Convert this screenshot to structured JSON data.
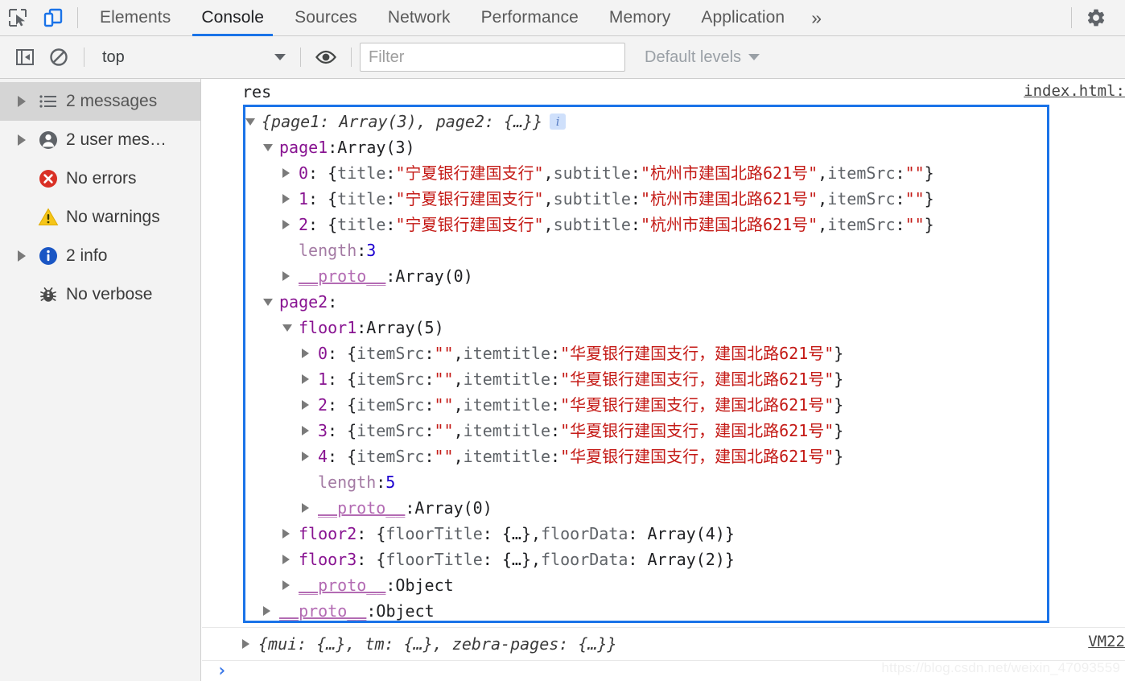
{
  "tabbar": {
    "inspect_icon": "inspect-element-icon",
    "device_icon": "device-toolbar-icon",
    "tabs": [
      {
        "label": "Elements",
        "active": false
      },
      {
        "label": "Console",
        "active": true
      },
      {
        "label": "Sources",
        "active": false
      },
      {
        "label": "Network",
        "active": false
      },
      {
        "label": "Performance",
        "active": false
      },
      {
        "label": "Memory",
        "active": false
      },
      {
        "label": "Application",
        "active": false
      }
    ],
    "more_label": "»",
    "settings_icon": "gear-icon"
  },
  "filterbar": {
    "sidebar_toggle_icon": "show-console-sidebar-icon",
    "clear_icon": "clear-console-icon",
    "context": "top",
    "eye_icon": "live-expression-icon",
    "filter_value": "",
    "filter_placeholder": "Filter",
    "levels_label": "Default levels"
  },
  "sidebar": {
    "items": [
      {
        "label": "2 messages",
        "icon": "list-icon",
        "expandable": true,
        "selected": true
      },
      {
        "label": "2 user mes…",
        "icon": "user-icon",
        "expandable": true,
        "selected": false
      },
      {
        "label": "No errors",
        "icon": "error-icon",
        "expandable": false,
        "selected": false
      },
      {
        "label": "No warnings",
        "icon": "warning-icon",
        "expandable": false,
        "selected": false
      },
      {
        "label": "2 info",
        "icon": "info-icon",
        "expandable": true,
        "selected": false
      },
      {
        "label": "No verbose",
        "icon": "bug-icon",
        "expandable": false,
        "selected": false
      }
    ]
  },
  "console": {
    "res_label": "res",
    "source_link": "index.html:",
    "vm_link": "VM22",
    "info_badge": "i",
    "root_preview": "{page1: Array(3), page2: {…}}",
    "tree": [
      {
        "indent": 0,
        "arrow": "down",
        "parts": [
          {
            "t": "{page1: Array(3), page2: {…}}",
            "c": "t-italic"
          }
        ],
        "badge": true
      },
      {
        "indent": 1,
        "arrow": "down",
        "parts": [
          {
            "t": "page1",
            "c": "k-prop"
          },
          {
            "t": ": ",
            "c": "t-plain"
          },
          {
            "t": "Array(3)",
            "c": "t-plain"
          }
        ]
      },
      {
        "indent": 2,
        "arrow": "right",
        "parts": [
          {
            "t": "0",
            "c": "k-idx"
          },
          {
            "t": ": {",
            "c": "t-plain"
          },
          {
            "t": "title",
            "c": "t-dim"
          },
          {
            "t": ": ",
            "c": "t-plain"
          },
          {
            "t": "\"宁夏银行建国支行\"",
            "c": "t-str"
          },
          {
            "t": ", ",
            "c": "t-plain"
          },
          {
            "t": "subtitle",
            "c": "t-dim"
          },
          {
            "t": ": ",
            "c": "t-plain"
          },
          {
            "t": "\"杭州市建国北路621号\"",
            "c": "t-str"
          },
          {
            "t": ", ",
            "c": "t-plain"
          },
          {
            "t": "itemSrc",
            "c": "t-dim"
          },
          {
            "t": ": ",
            "c": "t-plain"
          },
          {
            "t": "\"\"",
            "c": "t-str"
          },
          {
            "t": "}",
            "c": "t-plain"
          }
        ]
      },
      {
        "indent": 2,
        "arrow": "right",
        "parts": [
          {
            "t": "1",
            "c": "k-idx"
          },
          {
            "t": ": {",
            "c": "t-plain"
          },
          {
            "t": "title",
            "c": "t-dim"
          },
          {
            "t": ": ",
            "c": "t-plain"
          },
          {
            "t": "\"宁夏银行建国支行\"",
            "c": "t-str"
          },
          {
            "t": ", ",
            "c": "t-plain"
          },
          {
            "t": "subtitle",
            "c": "t-dim"
          },
          {
            "t": ": ",
            "c": "t-plain"
          },
          {
            "t": "\"杭州市建国北路621号\"",
            "c": "t-str"
          },
          {
            "t": ", ",
            "c": "t-plain"
          },
          {
            "t": "itemSrc",
            "c": "t-dim"
          },
          {
            "t": ": ",
            "c": "t-plain"
          },
          {
            "t": "\"\"",
            "c": "t-str"
          },
          {
            "t": "}",
            "c": "t-plain"
          }
        ]
      },
      {
        "indent": 2,
        "arrow": "right",
        "parts": [
          {
            "t": "2",
            "c": "k-idx"
          },
          {
            "t": ": {",
            "c": "t-plain"
          },
          {
            "t": "title",
            "c": "t-dim"
          },
          {
            "t": ": ",
            "c": "t-plain"
          },
          {
            "t": "\"宁夏银行建国支行\"",
            "c": "t-str"
          },
          {
            "t": ", ",
            "c": "t-plain"
          },
          {
            "t": "subtitle",
            "c": "t-dim"
          },
          {
            "t": ": ",
            "c": "t-plain"
          },
          {
            "t": "\"杭州市建国北路621号\"",
            "c": "t-str"
          },
          {
            "t": ", ",
            "c": "t-plain"
          },
          {
            "t": "itemSrc",
            "c": "t-dim"
          },
          {
            "t": ": ",
            "c": "t-plain"
          },
          {
            "t": "\"\"",
            "c": "t-str"
          },
          {
            "t": "}",
            "c": "t-plain"
          }
        ]
      },
      {
        "indent": 2,
        "arrow": "none",
        "parts": [
          {
            "t": "length",
            "c": "k-len"
          },
          {
            "t": ": ",
            "c": "t-plain"
          },
          {
            "t": "3",
            "c": "t-num"
          }
        ]
      },
      {
        "indent": 2,
        "arrow": "right",
        "parts": [
          {
            "t": "__proto__",
            "c": "k-proto"
          },
          {
            "t": ": ",
            "c": "t-plain"
          },
          {
            "t": "Array(0)",
            "c": "t-plain"
          }
        ]
      },
      {
        "indent": 1,
        "arrow": "down",
        "parts": [
          {
            "t": "page2",
            "c": "k-prop"
          },
          {
            "t": ":",
            "c": "t-plain"
          }
        ]
      },
      {
        "indent": 2,
        "arrow": "down",
        "parts": [
          {
            "t": "floor1",
            "c": "k-prop"
          },
          {
            "t": ": ",
            "c": "t-plain"
          },
          {
            "t": "Array(5)",
            "c": "t-plain"
          }
        ]
      },
      {
        "indent": 3,
        "arrow": "right",
        "parts": [
          {
            "t": "0",
            "c": "k-idx"
          },
          {
            "t": ": {",
            "c": "t-plain"
          },
          {
            "t": "itemSrc",
            "c": "t-dim"
          },
          {
            "t": ": ",
            "c": "t-plain"
          },
          {
            "t": "\"\"",
            "c": "t-str"
          },
          {
            "t": ", ",
            "c": "t-plain"
          },
          {
            "t": "itemtitle",
            "c": "t-dim"
          },
          {
            "t": ": ",
            "c": "t-plain"
          },
          {
            "t": "\"华夏银行建国支行，建国北路621号\"",
            "c": "t-str"
          },
          {
            "t": "}",
            "c": "t-plain"
          }
        ]
      },
      {
        "indent": 3,
        "arrow": "right",
        "parts": [
          {
            "t": "1",
            "c": "k-idx"
          },
          {
            "t": ": {",
            "c": "t-plain"
          },
          {
            "t": "itemSrc",
            "c": "t-dim"
          },
          {
            "t": ": ",
            "c": "t-plain"
          },
          {
            "t": "\"\"",
            "c": "t-str"
          },
          {
            "t": ", ",
            "c": "t-plain"
          },
          {
            "t": "itemtitle",
            "c": "t-dim"
          },
          {
            "t": ": ",
            "c": "t-plain"
          },
          {
            "t": "\"华夏银行建国支行，建国北路621号\"",
            "c": "t-str"
          },
          {
            "t": "}",
            "c": "t-plain"
          }
        ]
      },
      {
        "indent": 3,
        "arrow": "right",
        "parts": [
          {
            "t": "2",
            "c": "k-idx"
          },
          {
            "t": ": {",
            "c": "t-plain"
          },
          {
            "t": "itemSrc",
            "c": "t-dim"
          },
          {
            "t": ": ",
            "c": "t-plain"
          },
          {
            "t": "\"\"",
            "c": "t-str"
          },
          {
            "t": ", ",
            "c": "t-plain"
          },
          {
            "t": "itemtitle",
            "c": "t-dim"
          },
          {
            "t": ": ",
            "c": "t-plain"
          },
          {
            "t": "\"华夏银行建国支行，建国北路621号\"",
            "c": "t-str"
          },
          {
            "t": "}",
            "c": "t-plain"
          }
        ]
      },
      {
        "indent": 3,
        "arrow": "right",
        "parts": [
          {
            "t": "3",
            "c": "k-idx"
          },
          {
            "t": ": {",
            "c": "t-plain"
          },
          {
            "t": "itemSrc",
            "c": "t-dim"
          },
          {
            "t": ": ",
            "c": "t-plain"
          },
          {
            "t": "\"\"",
            "c": "t-str"
          },
          {
            "t": ", ",
            "c": "t-plain"
          },
          {
            "t": "itemtitle",
            "c": "t-dim"
          },
          {
            "t": ": ",
            "c": "t-plain"
          },
          {
            "t": "\"华夏银行建国支行，建国北路621号\"",
            "c": "t-str"
          },
          {
            "t": "}",
            "c": "t-plain"
          }
        ]
      },
      {
        "indent": 3,
        "arrow": "right",
        "parts": [
          {
            "t": "4",
            "c": "k-idx"
          },
          {
            "t": ": {",
            "c": "t-plain"
          },
          {
            "t": "itemSrc",
            "c": "t-dim"
          },
          {
            "t": ": ",
            "c": "t-plain"
          },
          {
            "t": "\"\"",
            "c": "t-str"
          },
          {
            "t": ", ",
            "c": "t-plain"
          },
          {
            "t": "itemtitle",
            "c": "t-dim"
          },
          {
            "t": ": ",
            "c": "t-plain"
          },
          {
            "t": "\"华夏银行建国支行，建国北路621号\"",
            "c": "t-str"
          },
          {
            "t": "}",
            "c": "t-plain"
          }
        ]
      },
      {
        "indent": 3,
        "arrow": "none",
        "parts": [
          {
            "t": "length",
            "c": "k-len"
          },
          {
            "t": ": ",
            "c": "t-plain"
          },
          {
            "t": "5",
            "c": "t-num"
          }
        ]
      },
      {
        "indent": 3,
        "arrow": "right",
        "parts": [
          {
            "t": "__proto__",
            "c": "k-proto"
          },
          {
            "t": ": ",
            "c": "t-plain"
          },
          {
            "t": "Array(0)",
            "c": "t-plain"
          }
        ]
      },
      {
        "indent": 2,
        "arrow": "right",
        "parts": [
          {
            "t": "floor2",
            "c": "k-prop"
          },
          {
            "t": ": {",
            "c": "t-plain"
          },
          {
            "t": "floorTitle",
            "c": "t-dim"
          },
          {
            "t": ": {…}, ",
            "c": "t-plain"
          },
          {
            "t": "floorData",
            "c": "t-dim"
          },
          {
            "t": ": Array(4)}",
            "c": "t-plain"
          }
        ]
      },
      {
        "indent": 2,
        "arrow": "right",
        "parts": [
          {
            "t": "floor3",
            "c": "k-prop"
          },
          {
            "t": ": {",
            "c": "t-plain"
          },
          {
            "t": "floorTitle",
            "c": "t-dim"
          },
          {
            "t": ": {…}, ",
            "c": "t-plain"
          },
          {
            "t": "floorData",
            "c": "t-dim"
          },
          {
            "t": ": Array(2)}",
            "c": "t-plain"
          }
        ]
      },
      {
        "indent": 2,
        "arrow": "right",
        "parts": [
          {
            "t": "__proto__",
            "c": "k-proto"
          },
          {
            "t": ": ",
            "c": "t-plain"
          },
          {
            "t": "Object",
            "c": "t-plain"
          }
        ]
      },
      {
        "indent": 1,
        "arrow": "right",
        "parts": [
          {
            "t": "__proto__",
            "c": "k-proto"
          },
          {
            "t": ": ",
            "c": "t-plain"
          },
          {
            "t": "Object",
            "c": "t-plain"
          }
        ]
      }
    ],
    "bottom_message": [
      {
        "t": "{mui: {…}, tm: {…}, zebra-pages: {…}}",
        "c": "t-italic"
      }
    ],
    "prompt_caret": "›"
  },
  "watermark": "https://blog.csdn.net/weixin_47093559",
  "colors": {
    "accent": "#1a73e8",
    "string": "#c41a16",
    "number": "#1c00cf",
    "property": "#881391",
    "proto": "#b36bb3",
    "toolbar_bg": "#f3f3f3",
    "error": "#d93025",
    "warning": "#f5c518",
    "info": "#1a73e8"
  }
}
